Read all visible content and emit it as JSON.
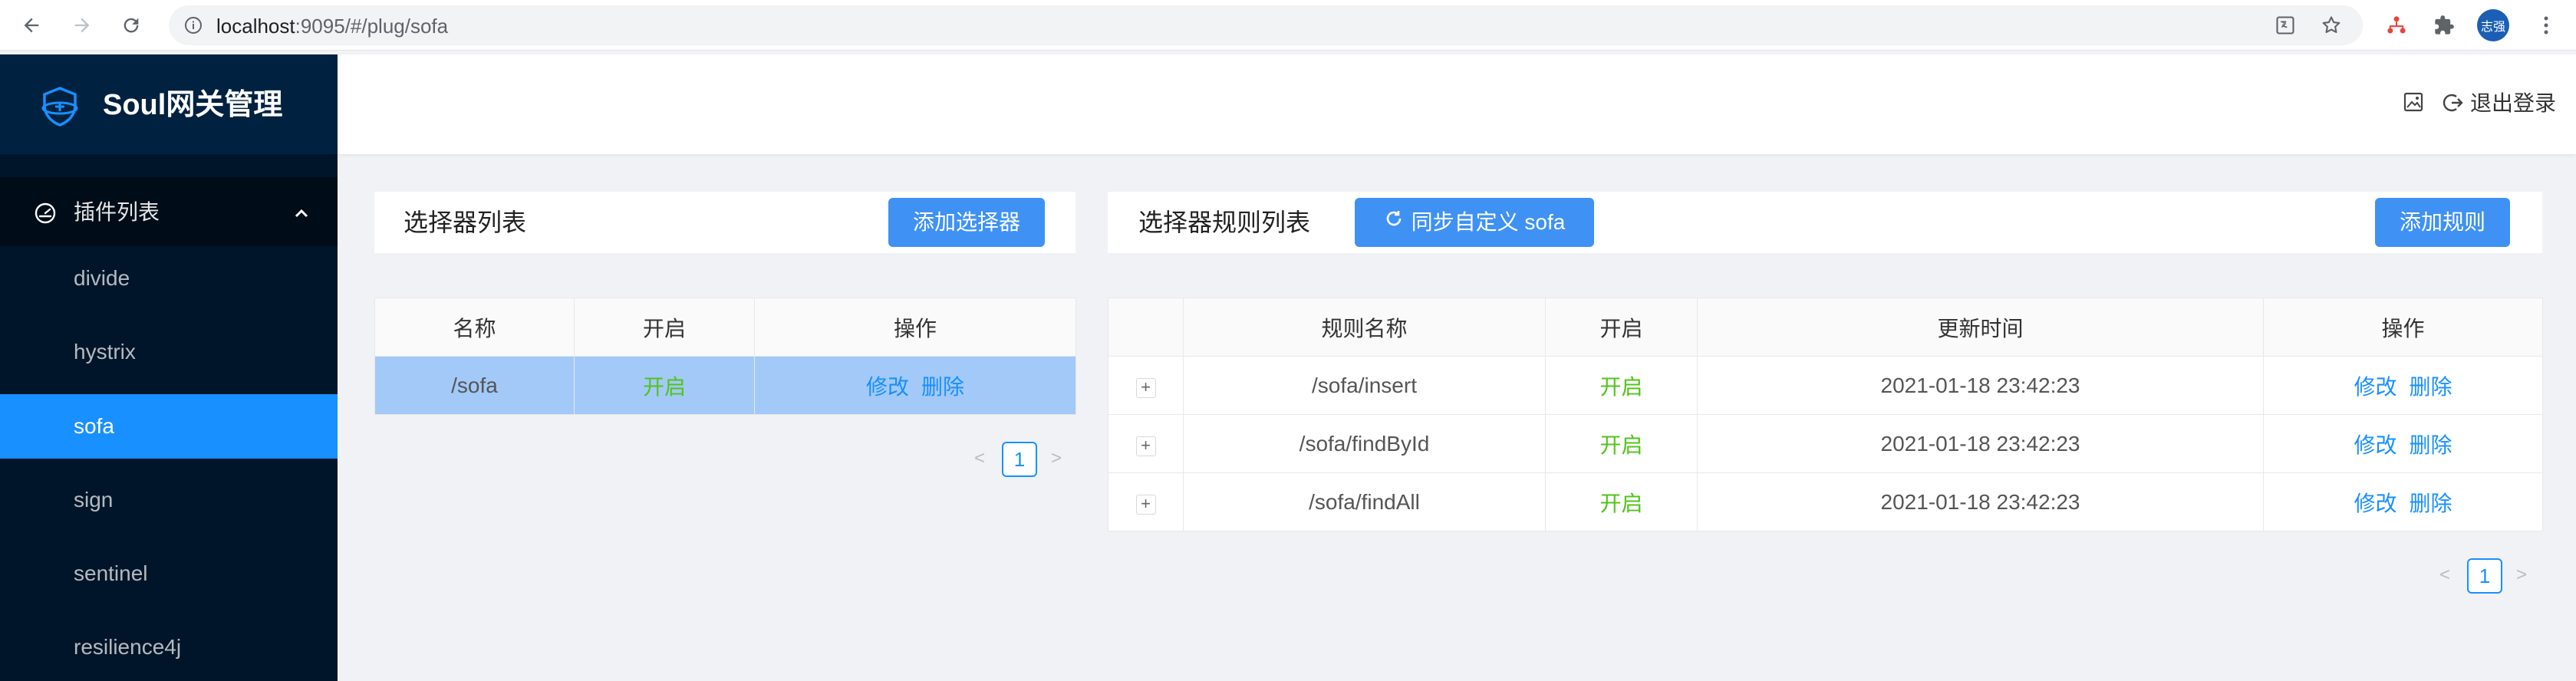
{
  "browser": {
    "url_host": "localhost",
    "url_rest": ":9095/#/plug/sofa",
    "profile_label": "志强"
  },
  "sidebar": {
    "app_title": "Soul网关管理",
    "submenu_label": "插件列表",
    "items": [
      {
        "label": "divide"
      },
      {
        "label": "hystrix"
      },
      {
        "label": "sofa"
      },
      {
        "label": "sign"
      },
      {
        "label": "sentinel"
      },
      {
        "label": "resilience4j"
      }
    ],
    "active_index": 2
  },
  "header": {
    "logout_label": "退出登录"
  },
  "selector_panel": {
    "title": "选择器列表",
    "add_button": "添加选择器",
    "columns": [
      "名称",
      "开启",
      "操作"
    ],
    "rows": [
      {
        "name": "/sofa",
        "enabled": "开启",
        "edit": "修改",
        "delete": "删除"
      }
    ],
    "page": "1"
  },
  "rule_panel": {
    "title": "选择器规则列表",
    "sync_button": "同步自定义 sofa",
    "add_button": "添加规则",
    "columns": [
      "",
      "规则名称",
      "开启",
      "更新时间",
      "操作"
    ],
    "rows": [
      {
        "expand": "+",
        "name": "/sofa/insert",
        "enabled": "开启",
        "updated": "2021-01-18 23:42:23",
        "edit": "修改",
        "delete": "删除"
      },
      {
        "expand": "+",
        "name": "/sofa/findById",
        "enabled": "开启",
        "updated": "2021-01-18 23:42:23",
        "edit": "修改",
        "delete": "删除"
      },
      {
        "expand": "+",
        "name": "/sofa/findAll",
        "enabled": "开启",
        "updated": "2021-01-18 23:42:23",
        "edit": "修改",
        "delete": "删除"
      }
    ],
    "page": "1"
  },
  "colors": {
    "primary": "#1890ff",
    "button": "#3f92f4",
    "sidebar_bg": "#001529",
    "enabled_green": "#52c41a",
    "selected_row": "#a3c9f8"
  },
  "icons": [
    "back-arrow-icon",
    "forward-arrow-icon",
    "reload-icon",
    "info-icon",
    "translate-icon",
    "star-icon",
    "extension-puzzle-icon",
    "soul-logo-icon",
    "dashboard-icon",
    "chevron-up-icon",
    "image-export-icon",
    "logout-icon",
    "sync-icon"
  ]
}
